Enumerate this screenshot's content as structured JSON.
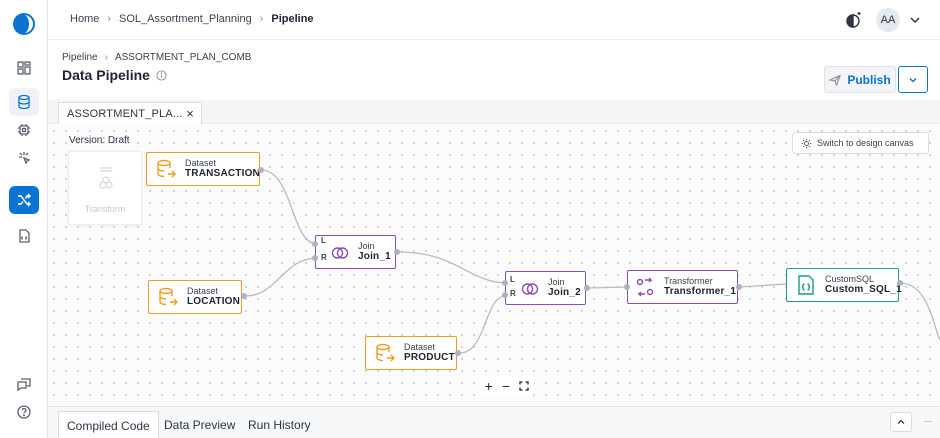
{
  "breadcrumbs": [
    "Home",
    "SOL_Assortment_Planning",
    "Pipeline"
  ],
  "user": {
    "initials": "AA"
  },
  "sub_breadcrumbs": [
    "Pipeline",
    "ASSORTMENT_PLAN_COMB"
  ],
  "page_title": "Data Pipeline",
  "publish_label": "Publish",
  "file_tab": {
    "label": "ASSORTMENT_PLA...",
    "close": "×"
  },
  "canvas": {
    "version": "Version: Draft",
    "ghost_label": "Transform",
    "switch_label": "Switch to design canvas"
  },
  "nodes": {
    "transaction": {
      "type": "Dataset",
      "name": "TRANSACTION",
      "icon": "database-icon"
    },
    "location": {
      "type": "Dataset",
      "name": "LOCATION",
      "icon": "database-icon"
    },
    "product": {
      "type": "Dataset",
      "name": "PRODUCT",
      "icon": "database-icon"
    },
    "join1": {
      "type": "Join",
      "name": "Join_1",
      "icon": "join-icon",
      "port_l": "L",
      "port_r": "R"
    },
    "join2": {
      "type": "Join",
      "name": "Join_2",
      "icon": "join-icon",
      "port_l": "L",
      "port_r": "R"
    },
    "transformer1": {
      "type": "Transformer",
      "name": "Transformer_1",
      "icon": "transform-icon"
    },
    "sql1": {
      "type": "CustomSQL",
      "name": "Custom_SQL_1",
      "icon": "sql-file-icon"
    }
  },
  "zoom_controls": {
    "zoom_in": "+",
    "zoom_out": "−",
    "fit": "fit-screen-icon"
  },
  "bottom_tabs": [
    "Compiled Code",
    "Data Preview",
    "Run History"
  ],
  "colors": {
    "accent": "#0b74d1",
    "dataset": "#f39a1e",
    "join": "#8a4bb8",
    "sql": "#1b9a8a"
  }
}
